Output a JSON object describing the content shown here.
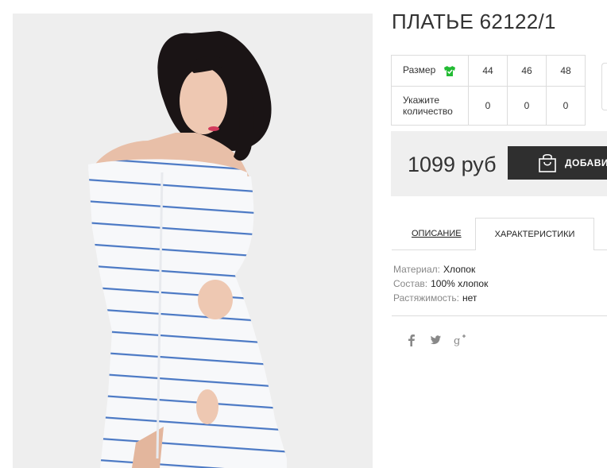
{
  "product": {
    "title": "ПЛАТЬЕ 62122/1",
    "image_alt": "model wearing off-shoulder white dress with blue stripes"
  },
  "sizes": {
    "size_label": "Размер",
    "qty_label": "Укажите количество",
    "sizes": [
      "44",
      "46",
      "48"
    ],
    "quantities": [
      "0",
      "0",
      "0"
    ],
    "shirt_icon": "tshirt-icon",
    "shirt_icon_color": "#22bb33"
  },
  "buy": {
    "price": "1099 руб",
    "add_label": "ДОБАВИТ",
    "bag_icon": "shopping-bag-icon"
  },
  "tabs": {
    "description": "ОПИСАНИЕ",
    "characteristics": "ХАРАКТЕРИСТИКИ",
    "active": "characteristics"
  },
  "specs": [
    {
      "name": "Материал:",
      "value": "Хлопок"
    },
    {
      "name": "Состав:",
      "value": "100% хлопок"
    },
    {
      "name": "Растяжимость:",
      "value": "нет"
    }
  ],
  "social": [
    "facebook-icon",
    "twitter-icon",
    "google-plus-icon"
  ],
  "colors": {
    "stripe": "#4a78c4",
    "button_bg": "#2f2f2f",
    "buy_box_bg": "#efefef"
  }
}
